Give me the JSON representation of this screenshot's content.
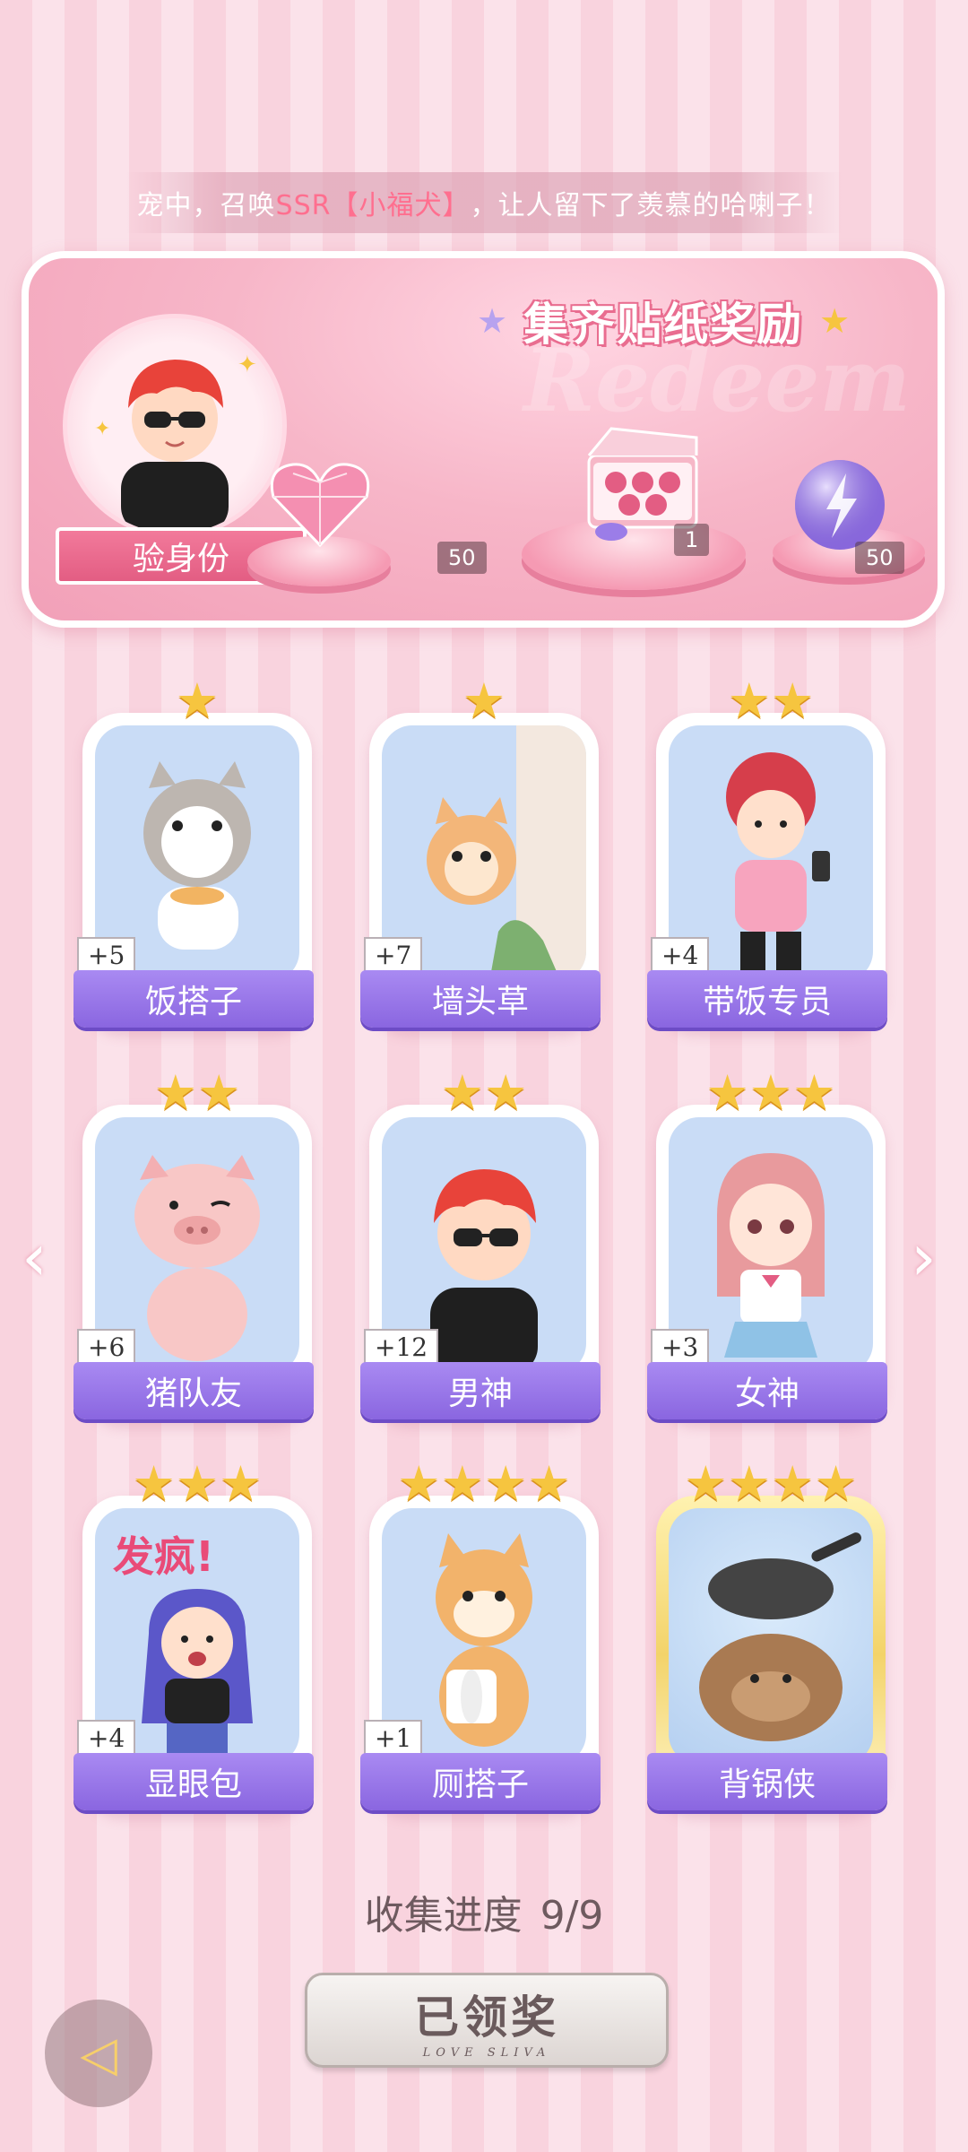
{
  "marquee": {
    "prefix": "宠中，召唤",
    "highlight": "SSR【小福犬】",
    "suffix": "，让人留下了羡慕的哈喇子！"
  },
  "reward_panel": {
    "title": "集齐贴纸奖励",
    "watermark": "Redeem",
    "identity_label": "验身份",
    "rewards": [
      {
        "icon": "pink-diamond-heart-icon",
        "count": "50"
      },
      {
        "icon": "gift-box-icon",
        "count": "1"
      },
      {
        "icon": "lightning-orb-icon",
        "count": "50"
      }
    ]
  },
  "stickers": [
    {
      "name": "饭搭子",
      "stars": 1,
      "plus": "+5",
      "art": "cat-eating-icon"
    },
    {
      "name": "墙头草",
      "stars": 1,
      "plus": "+7",
      "art": "cat-peeking-icon"
    },
    {
      "name": "带饭专员",
      "stars": 2,
      "plus": "+4",
      "art": "girl-with-phone-icon"
    },
    {
      "name": "猪队友",
      "stars": 2,
      "plus": "+6",
      "art": "pig-winking-icon"
    },
    {
      "name": "男神",
      "stars": 2,
      "plus": "+12",
      "art": "boy-sunglasses-icon"
    },
    {
      "name": "女神",
      "stars": 3,
      "plus": "+3",
      "art": "girl-sailor-icon"
    },
    {
      "name": "显眼包",
      "stars": 3,
      "plus": "+4",
      "art": "girl-crazy-icon"
    },
    {
      "name": "厕搭子",
      "stars": 4,
      "plus": "+1",
      "art": "shiba-toilet-paper-icon"
    },
    {
      "name": "背锅侠",
      "stars": 4,
      "plus": "",
      "art": "capybara-pan-icon"
    }
  ],
  "sticker_art_text": "发疯!",
  "progress": {
    "label": "收集进度",
    "value": "9/9"
  },
  "claim_button": {
    "label": "已领奖",
    "sub": "LOVE SLIVA"
  },
  "colors": {
    "accent_pink": "#e96d90",
    "label_purple": "#8a66e0",
    "star_gold": "#f6c53f"
  }
}
